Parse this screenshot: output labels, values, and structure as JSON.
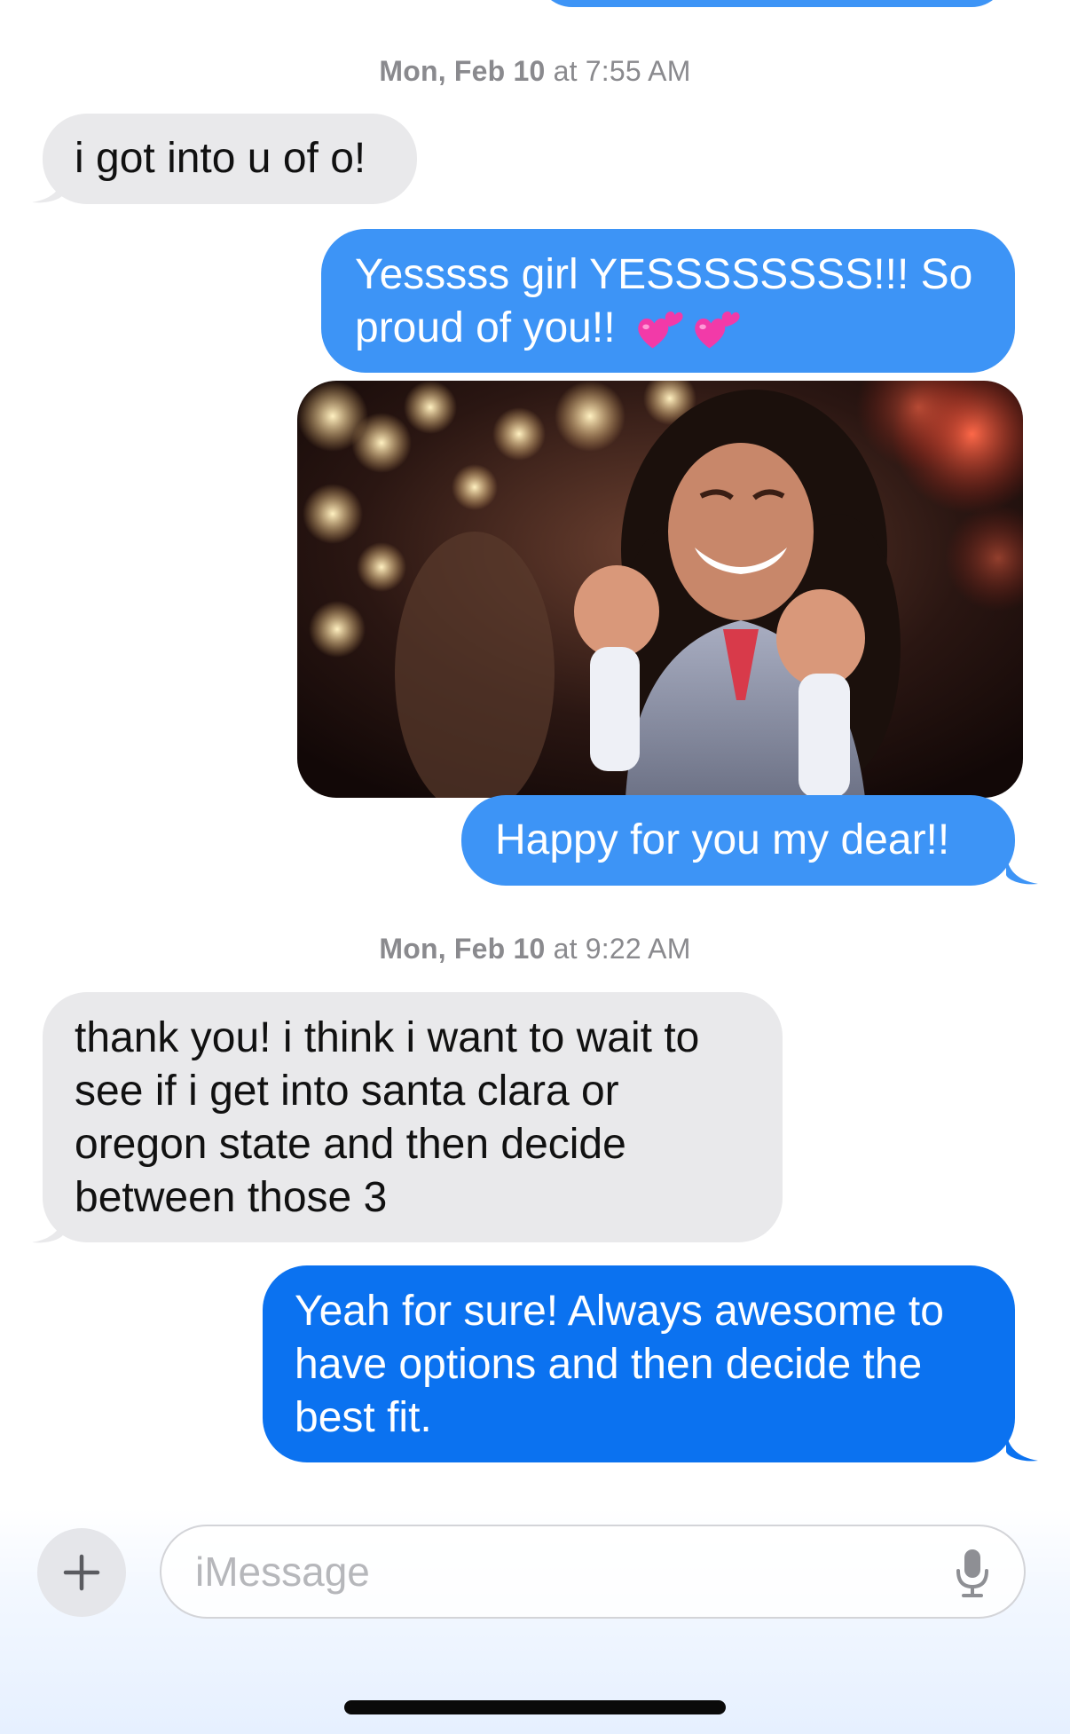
{
  "conversation": {
    "timestamps": [
      {
        "day": "Mon, Feb 10",
        "at": " at ",
        "time": "7:55 AM"
      },
      {
        "day": "Mon, Feb 10",
        "at": " at ",
        "time": "9:22 AM"
      }
    ],
    "messages": [
      {
        "direction": "incoming",
        "text": "i got into u of o!"
      },
      {
        "direction": "outgoing",
        "line1": "Yesssss girl YESSSSSSSS!!! So",
        "line2": "proud of you!! ",
        "emoji": "heart-emoji ×2"
      },
      {
        "direction": "outgoing",
        "type": "gif",
        "description": "girl clenching fists excitedly"
      },
      {
        "direction": "outgoing",
        "text": "Happy for you my dear!!"
      },
      {
        "direction": "incoming",
        "lines": [
          "thank you! i think i want to wait to",
          "see if i get into santa clara or",
          "oregon state and then decide",
          "between those 3"
        ]
      },
      {
        "direction": "outgoing",
        "lines": [
          "Yeah for sure! Always awesome to",
          "have options and then decide the",
          "best fit."
        ]
      }
    ]
  },
  "composer": {
    "placeholder": "iMessage",
    "plus_icon": "plus-icon",
    "mic_icon": "microphone-icon"
  },
  "colors": {
    "incoming_bubble": "#e9e9eb",
    "outgoing_bubble": "#3d94f6",
    "outgoing_bubble_latest": "#0b72f0",
    "timestamp": "#8a8a8e"
  }
}
